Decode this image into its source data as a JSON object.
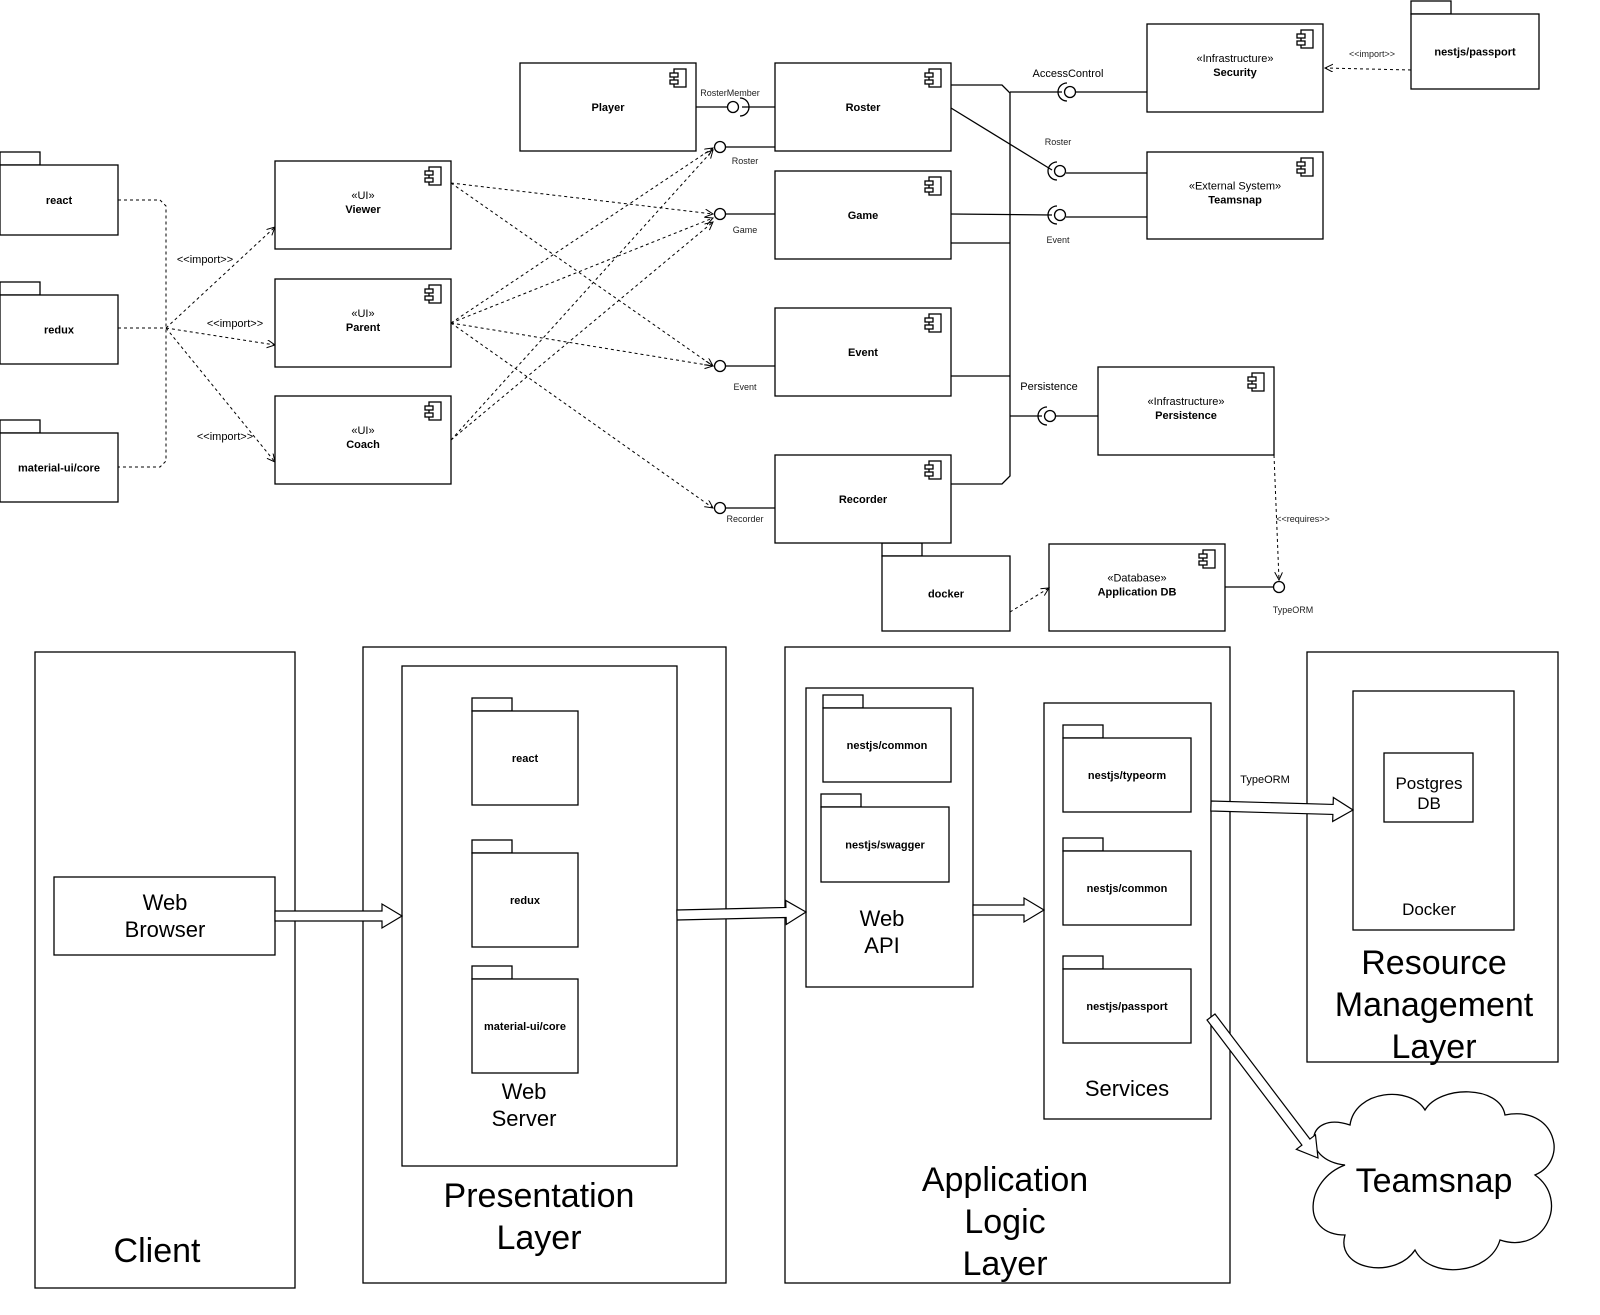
{
  "components": {
    "player": {
      "name": "Player"
    },
    "roster": {
      "name": "Roster"
    },
    "game": {
      "name": "Game"
    },
    "event": {
      "name": "Event"
    },
    "recorder": {
      "name": "Recorder"
    },
    "viewer": {
      "stereotype": "«UI»",
      "name": "Viewer"
    },
    "parent": {
      "stereotype": "«UI»",
      "name": "Parent"
    },
    "coach": {
      "stereotype": "«UI»",
      "name": "Coach"
    },
    "security": {
      "stereotype": "«Infrastructure»",
      "name": "Security"
    },
    "teamsnap": {
      "stereotype": "«External System»",
      "name": "Teamsnap"
    },
    "persistence": {
      "stereotype": "«Infrastructure»",
      "name": "Persistence"
    },
    "appdb": {
      "stereotype": "«Database»",
      "name": "Application DB"
    }
  },
  "packages": {
    "react": "react",
    "redux": "redux",
    "mui": "material-ui/core",
    "passport_top": "nestjs/passport",
    "docker": "docker",
    "ws_react": "react",
    "ws_redux": "redux",
    "ws_mui": "material-ui/core",
    "api_common": "nestjs/common",
    "api_swagger": "nestjs/swagger",
    "svc_typeorm": "nestjs/typeorm",
    "svc_common": "nestjs/common",
    "svc_passport": "nestjs/passport"
  },
  "interfaces": {
    "rostermember": "RosterMember",
    "roster_l": "Roster",
    "game_l": "Game",
    "event_l": "Event",
    "recorder_l": "Recorder",
    "accesscontrol": "AccessControl",
    "roster_r": "Roster",
    "event_r": "Event",
    "persistence": "Persistence",
    "typeorm": "TypeORM"
  },
  "labels": {
    "import1": "<<import>>",
    "import2": "<<import>>",
    "import3": "<<import>>",
    "import_passport": "<<import>>",
    "requires": "<<requires>>",
    "typeorm_arrow": "TypeORM"
  },
  "layers": {
    "client": "Client",
    "web_browser": [
      "Web",
      "Browser"
    ],
    "presentation": [
      "Presentation",
      "Layer"
    ],
    "web_server": [
      "Web",
      "Server"
    ],
    "app_logic": [
      "Application",
      "Logic",
      "Layer"
    ],
    "web_api": [
      "Web",
      "API"
    ],
    "services": "Services",
    "resource": [
      "Resource",
      "Management",
      "Layer"
    ],
    "postgres": [
      "Postgres",
      "DB"
    ],
    "docker": "Docker",
    "teamsnap": "Teamsnap"
  }
}
